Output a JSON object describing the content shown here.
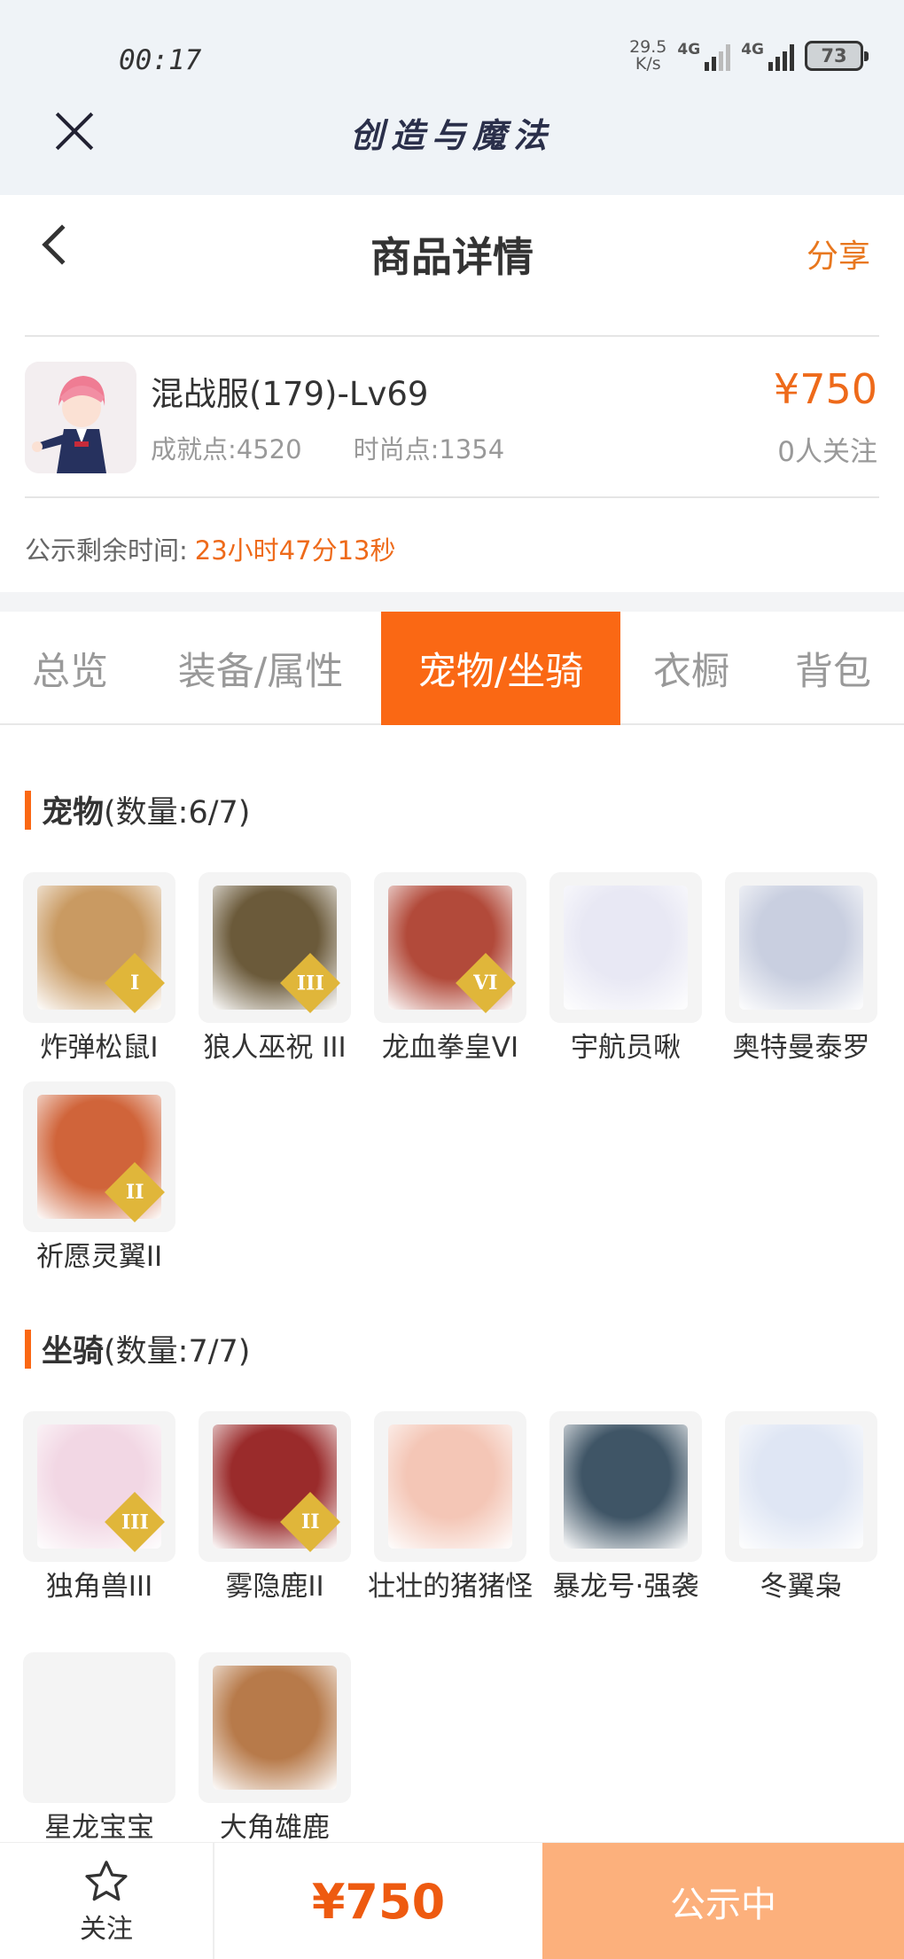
{
  "status_bar": {
    "time": "00:17",
    "net_speed_value": "29.5",
    "net_speed_unit": "K/s",
    "signal1_label": "4G",
    "signal2_label": "4G",
    "battery": "73"
  },
  "app": {
    "title": "创造与魔法"
  },
  "header": {
    "title": "商品详情",
    "share": "分享"
  },
  "product": {
    "name": "混战服(179)-Lv69",
    "achievement": "成就点:4520",
    "fashion": "时尚点:1354",
    "price": "¥750",
    "followers": "0人关注",
    "countdown_label": "公示剩余时间:",
    "countdown_value": "23小时47分13秒"
  },
  "tabs": [
    {
      "label": "总览",
      "active": false
    },
    {
      "label": "装备/属性",
      "active": false
    },
    {
      "label": "宠物/坐骑",
      "active": true
    },
    {
      "label": "衣橱",
      "active": false
    },
    {
      "label": "背包",
      "active": false
    }
  ],
  "pets": {
    "title": "宠物",
    "count": "(数量:6/7)",
    "items": [
      {
        "name": "炸弹松鼠Ⅰ",
        "rank": "I",
        "color": "#c99a62"
      },
      {
        "name": "狼人巫祝 III",
        "rank": "III",
        "color": "#6b5a3a"
      },
      {
        "name": "龙血拳皇VI",
        "rank": "VI",
        "color": "#b24a3a"
      },
      {
        "name": "宇航员啾",
        "rank": "",
        "color": "#e8e8f4"
      },
      {
        "name": "奥特曼泰罗",
        "rank": "",
        "color": "#c9cfe0"
      },
      {
        "name": "祈愿灵翼II",
        "rank": "II",
        "color": "#d0643a"
      }
    ]
  },
  "mounts": {
    "title": "坐骑",
    "count": "(数量:7/7)",
    "items": [
      {
        "name": "独角兽III",
        "rank": "III",
        "color": "#f2d7e4"
      },
      {
        "name": "雾隐鹿II",
        "rank": "II",
        "color": "#9a2b2b"
      },
      {
        "name": "壮壮的猪猪怪",
        "rank": "",
        "color": "#f4c6b6"
      },
      {
        "name": "暴龙号·强袭",
        "rank": "",
        "color": "#3f5566"
      },
      {
        "name": "冬翼枭",
        "rank": "",
        "color": "#dfe6f4"
      },
      {
        "name": "星龙宝宝",
        "rank": "",
        "color": ""
      },
      {
        "name": "大角雄鹿",
        "rank": "",
        "color": "#b77a4a"
      }
    ]
  },
  "bottom": {
    "follow_label": "关注",
    "price": "¥750",
    "status": "公示中"
  },
  "colors": {
    "accent": "#fa6814",
    "price": "#ee6a1a",
    "status_button": "#fcb07c"
  }
}
